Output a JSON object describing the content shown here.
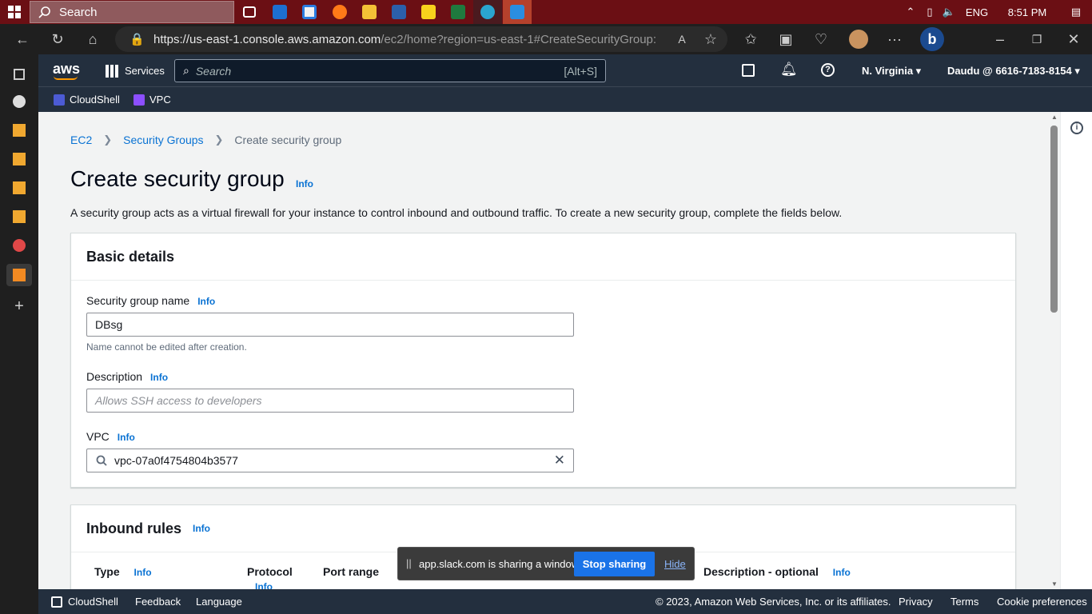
{
  "taskbar": {
    "search_label": "Search",
    "time": "8:51 PM",
    "language": "ENG"
  },
  "browser": {
    "url_host": "https://us-east-1.console.aws.amazon.com",
    "url_path": "/ec2/home?region=us-east-1#CreateSecurityGroup:"
  },
  "aws_nav": {
    "logo": "aws",
    "services_label": "Services",
    "search_placeholder": "Search",
    "search_shortcut": "[Alt+S]",
    "region": "N. Virginia",
    "account": "Daudu @ 6616-7183-8154",
    "favorites": [
      "CloudShell",
      "VPC"
    ]
  },
  "breadcrumb": {
    "items": [
      "EC2",
      "Security Groups"
    ],
    "current": "Create security group"
  },
  "page": {
    "title": "Create security group",
    "info": "Info",
    "description": "A security group acts as a virtual firewall for your instance to control inbound and outbound traffic. To create a new security group, complete the fields below."
  },
  "basic_details": {
    "heading": "Basic details",
    "name_label": "Security group name",
    "name_value": "DBsg",
    "name_hint": "Name cannot be edited after creation.",
    "desc_label": "Description",
    "desc_placeholder": "Allows SSH access to developers",
    "vpc_label": "VPC",
    "vpc_value": "vpc-07a0f4754804b3577"
  },
  "inbound": {
    "heading": "Inbound rules",
    "columns": {
      "type": "Type",
      "protocol": "Protocol",
      "port_range": "Port range",
      "description": "Description - optional"
    }
  },
  "share_banner": {
    "text": "app.slack.com is sharing a window.",
    "stop_label": "Stop sharing",
    "hide_label": "Hide"
  },
  "footer": {
    "cloudshell": "CloudShell",
    "feedback": "Feedback",
    "language": "Language",
    "copyright": "© 2023, Amazon Web Services, Inc. or its affiliates.",
    "privacy": "Privacy",
    "terms": "Terms",
    "cookies": "Cookie preferences"
  }
}
